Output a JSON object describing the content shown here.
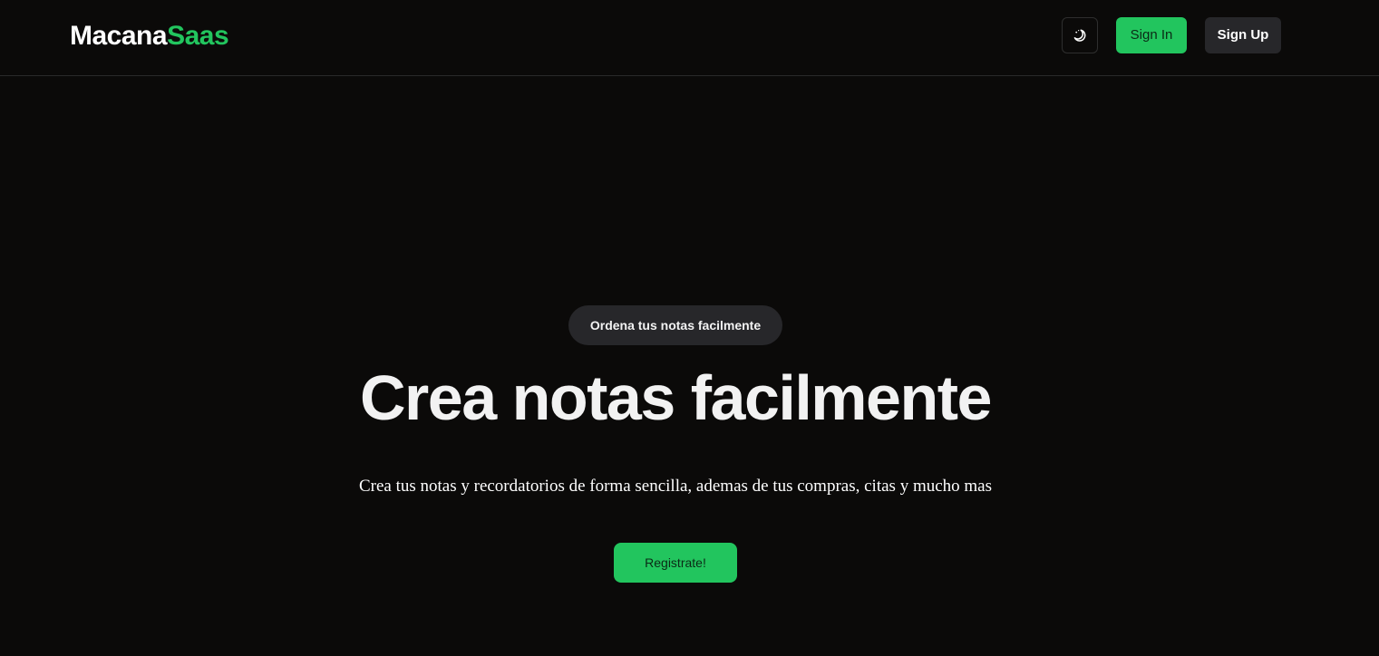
{
  "header": {
    "logo_part1": "Macana",
    "logo_part2": "Saas",
    "theme_toggle_icon": "moon-stars-icon",
    "signin_label": "Sign In",
    "signup_label": "Sign Up"
  },
  "hero": {
    "pill_label": "Ordena tus notas facilmente",
    "headline": "Crea notas facilmente",
    "subtitle": "Crea tus notas y recordatorios de forma sencilla, ademas de tus compras, citas y mucho mas",
    "cta_label": "Registrate!"
  },
  "colors": {
    "background": "#0b0a09",
    "accent": "#22c55e",
    "secondary_button": "#27272a"
  }
}
